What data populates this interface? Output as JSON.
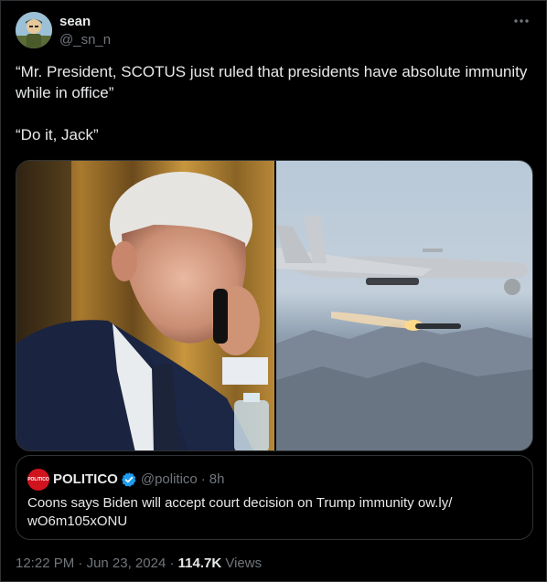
{
  "author": {
    "display_name": "sean",
    "handle": "@_sn_n"
  },
  "more_icon": "more-dots-icon",
  "tweet": {
    "text": "“Mr. President, SCOTUS just ruled that presidents have absolute immunity while in office”\n\n“Do it, Jack”"
  },
  "media": {
    "images": [
      {
        "name": "photo-man-on-phone"
      },
      {
        "name": "photo-drone-firing-missile"
      }
    ]
  },
  "quote": {
    "avatar_text": "POLITICO",
    "name": "POLITICO",
    "verified_icon": "verified-badge-icon",
    "handle": "@politico",
    "separator": "·",
    "time": "8h",
    "text": "Coons says Biden will accept court decision on Trump immunity ow.ly/ wO6m105xONU"
  },
  "meta": {
    "time": "12:22 PM",
    "separator1": " · ",
    "date": "Jun 23, 2024",
    "separator2": " · ",
    "views_count": "114.7K",
    "views_label": " Views"
  },
  "colors": {
    "background": "#000000",
    "text": "#e7e9ea",
    "secondary": "#71767b",
    "border": "#2f3336",
    "verified": "#1d9bf0",
    "politico_red": "#d0141e"
  }
}
